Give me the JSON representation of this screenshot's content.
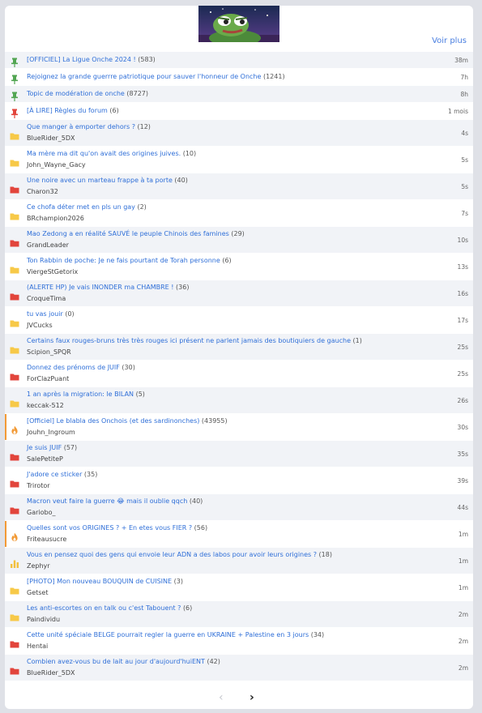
{
  "header": {
    "see_more_label": "Voir plus"
  },
  "topics": [
    {
      "icon": "pin-green-icon",
      "title": "[OFFICIEL] La Ligue Onche 2024 !",
      "count": "(583)",
      "author": "",
      "time": "38m"
    },
    {
      "icon": "pin-green-icon",
      "title": "Rejoignez la grande guerrre patriotique pour sauver l'honneur de Onche",
      "count": "(1241)",
      "author": "",
      "time": "7h"
    },
    {
      "icon": "pin-green-icon",
      "title": "Topic de modération de onche",
      "count": "(8727)",
      "author": "",
      "time": "8h"
    },
    {
      "icon": "pin-red-icon",
      "title": "[À LIRE] Règles du forum",
      "count": "(6)",
      "author": "",
      "time": "1 mois"
    },
    {
      "icon": "folder-yellow-icon",
      "title": "Que manger à emporter dehors ?",
      "count": "(12)",
      "author": "BlueRider_5DX",
      "time": "4s"
    },
    {
      "icon": "folder-yellow-icon",
      "title": "Ma mère ma dit qu'on avait des origines juives.",
      "count": "(10)",
      "author": "John_Wayne_Gacy",
      "time": "5s"
    },
    {
      "icon": "folder-red-icon",
      "title": "Une noire avec un marteau frappe à ta porte",
      "count": "(40)",
      "author": "Charon32",
      "time": "5s"
    },
    {
      "icon": "folder-yellow-icon",
      "title": "Ce chofa déter met en pls un gay",
      "count": "(2)",
      "author": "BRchampion2026",
      "time": "7s"
    },
    {
      "icon": "folder-red-icon",
      "title": "Mao Zedong a en réalité SAUVÉ le peuple Chinois des famines",
      "count": "(29)",
      "author": "GrandLeader",
      "time": "10s"
    },
    {
      "icon": "folder-yellow-icon",
      "title": "Ton Rabbin de poche: Je ne fais pourtant de Torah personne",
      "count": "(6)",
      "author": "ViergeStGetorix",
      "time": "13s"
    },
    {
      "icon": "folder-red-icon",
      "title": "(ALERTE HP) Je vais INONDER ma CHAMBRE !",
      "count": "(36)",
      "author": "CroqueTima",
      "time": "16s"
    },
    {
      "icon": "folder-yellow-icon",
      "title": "tu vas jouir",
      "count": "(0)",
      "author": "JVCucks",
      "time": "17s"
    },
    {
      "icon": "folder-yellow-icon",
      "title": "Certains faux rouges-bruns très très rouges ici présent ne parlent jamais des boutiquiers de gauche",
      "count": "(1)",
      "author": "Scipion_SPQR",
      "time": "25s"
    },
    {
      "icon": "folder-red-icon",
      "title": "Donnez des prénoms de JUIF",
      "count": "(30)",
      "author": "ForClazPuant",
      "time": "25s"
    },
    {
      "icon": "folder-yellow-icon",
      "title": "1 an après la migration: le BILAN",
      "count": "(5)",
      "author": "keccak-512",
      "time": "26s"
    },
    {
      "icon": "fire-icon",
      "title": "[Officiel] Le blabla des Onchois (et des sardinonches)",
      "count": "(43955)",
      "author": "Jouhn_Ingroum",
      "time": "30s",
      "accent": true
    },
    {
      "icon": "folder-red-icon",
      "title": "Je suis JUIF",
      "count": "(57)",
      "author": "SalePetiteP",
      "time": "35s"
    },
    {
      "icon": "folder-red-icon",
      "title": "J'adore ce sticker",
      "count": "(35)",
      "author": "Trirotor",
      "time": "39s"
    },
    {
      "icon": "folder-red-icon",
      "title": "Macron veut faire la guerre 😂 mais il oublie qqch",
      "count": "(40)",
      "author": "Gariobo_",
      "time": "44s"
    },
    {
      "icon": "fire-icon",
      "title": "Quelles sont vos ORIGINES ? + En etes vous FIER ?",
      "count": "(56)",
      "author": "Friteausucre",
      "time": "1m",
      "accent": true
    },
    {
      "icon": "poll-icon",
      "title": "Vous en pensez quoi des gens qui envoie leur ADN a des labos pour avoir leurs origines ?",
      "count": "(18)",
      "author": "Zephyr",
      "time": "1m"
    },
    {
      "icon": "folder-yellow-icon",
      "title": "[PHOTO] Mon nouveau BOUQUIN de CUISINE",
      "count": "(3)",
      "author": "Getset",
      "time": "1m"
    },
    {
      "icon": "folder-yellow-icon",
      "title": "Les anti-escortes on en talk ou c'est Tabouent ?",
      "count": "(6)",
      "author": "Paindividu",
      "time": "2m"
    },
    {
      "icon": "folder-red-icon",
      "title": "Cette unité spéciale BELGE pourrait regler la guerre en UKRAINE + Palestine en 3 jours",
      "count": "(34)",
      "author": "Hentai",
      "time": "2m"
    },
    {
      "icon": "folder-red-icon",
      "title": "Combien avez-vous bu de lait au jour d'aujourd'huiENT",
      "count": "(42)",
      "author": "BlueRider_5DX",
      "time": "2m"
    }
  ],
  "pagination": {
    "prev": "‹",
    "next": "›"
  },
  "colors": {
    "link": "#2f6fd8",
    "folder_yellow": "#f7c948",
    "folder_red": "#e2453c",
    "pin_green": "#53a653",
    "pin_red": "#e2453c",
    "fire": "#f29a36",
    "poll": "#f3c03c"
  }
}
